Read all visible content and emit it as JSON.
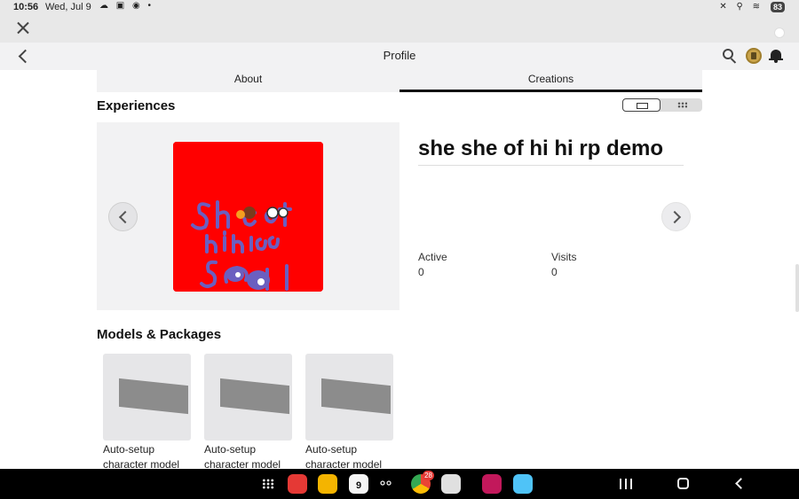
{
  "status_bar": {
    "time": "10:56",
    "date": "Wed, Jul 9",
    "notification_icons": "☁ ▣ ◉ •",
    "system_icons": "✕ ⚲ ≋",
    "battery": "83"
  },
  "header": {
    "title": "Profile"
  },
  "tabs": [
    {
      "label": "About",
      "active": false
    },
    {
      "label": "Creations",
      "active": true
    }
  ],
  "experiences": {
    "title": "Experiences",
    "item": {
      "name": "she she of hi hi rp demo",
      "thumbnail_color": "#ff0000",
      "stats": [
        {
          "label": "Active",
          "value": "0"
        },
        {
          "label": "Visits",
          "value": "0"
        }
      ]
    }
  },
  "models": {
    "title": "Models & Packages",
    "items": [
      {
        "name": "Auto-setup character model"
      },
      {
        "name": "Auto-setup character model"
      },
      {
        "name": "Auto-setup character model"
      }
    ]
  },
  "taskbar": {
    "calendar_day": "9",
    "chrome_badge": "28",
    "apps": [
      "apps-grid-icon",
      "flipboard-icon",
      "notes-icon",
      "calendar-icon",
      "bixby-icon",
      "chrome-icon",
      "camera-icon",
      "game-icon",
      "roblox-icon"
    ]
  }
}
